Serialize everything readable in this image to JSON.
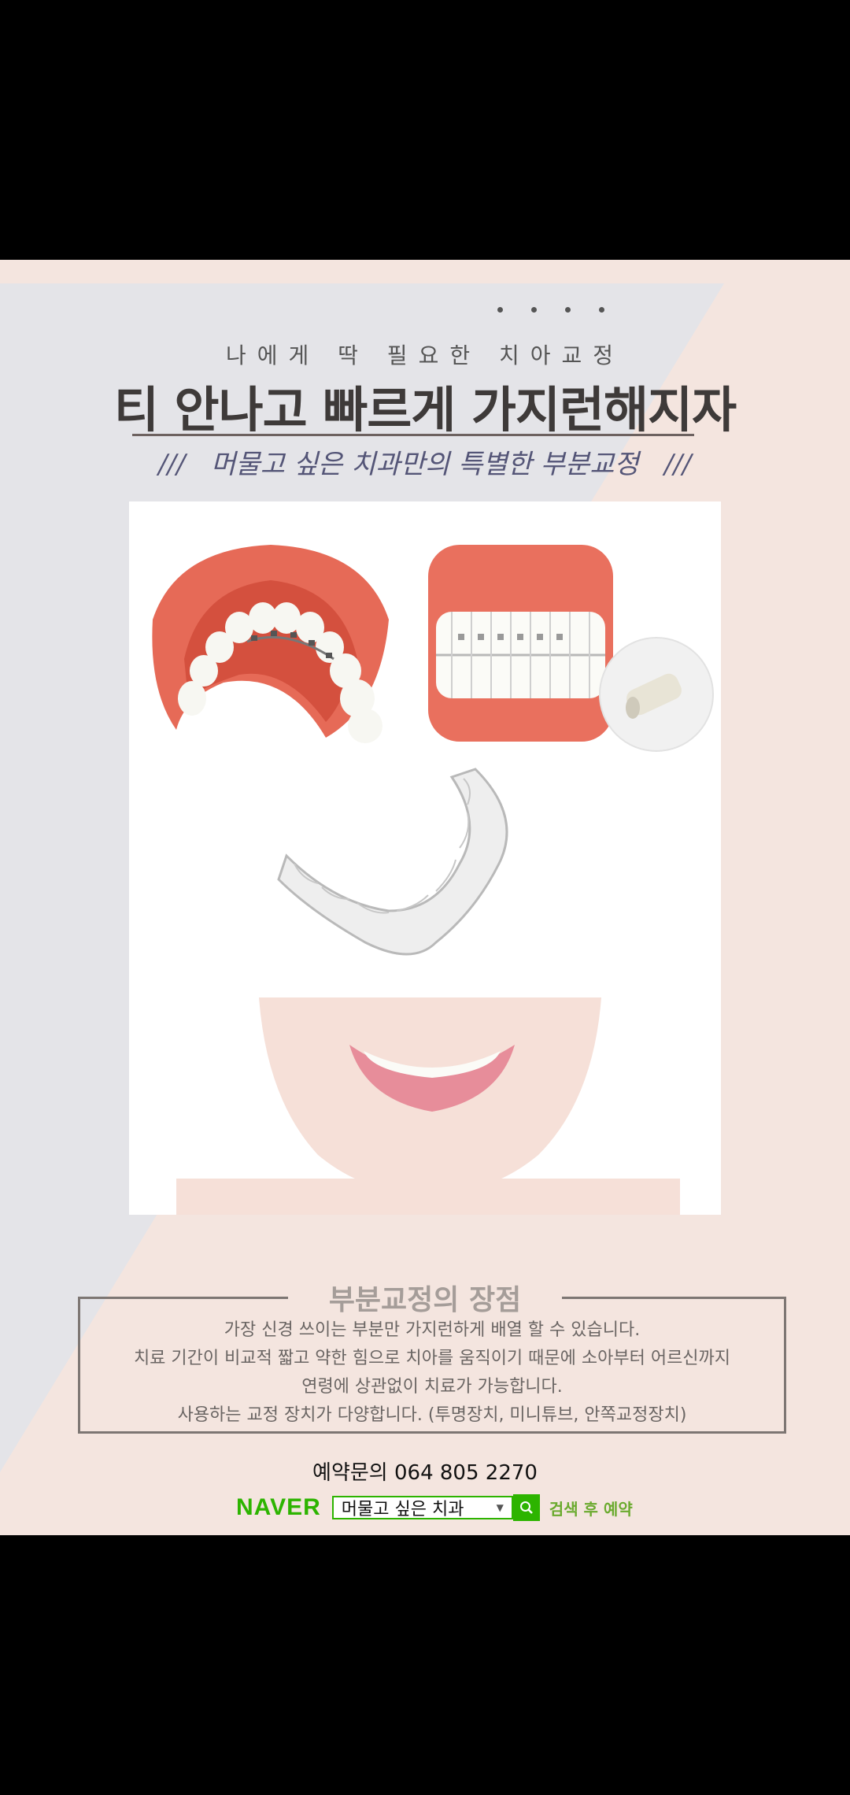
{
  "poster": {
    "subtitle": "나에게 딱 필요한 치아교정",
    "title": "티 안나고 빠르게 가지런해지자",
    "tagline": "///   머물고 싶은 치과만의 특별한 부분교정   ///"
  },
  "advantages": {
    "heading": "부분교정의 장점",
    "lines": [
      "가장 신경 쓰이는 부분만 가지런하게 배열 할 수 있습니다.",
      "치료 기간이 비교적 짧고 약한 힘으로 치아를 움직이기 때문에 소아부터 어르신까지",
      "연령에 상관없이 치료가 가능합니다.",
      "사용하는 교정 장치가 다양합니다. (투명장치, 미니튜브, 안쪽교정장치)"
    ]
  },
  "contact": {
    "phone": "예약문의 064 805 2270"
  },
  "naver": {
    "logo": "NAVER",
    "search_value": "머물고 싶은 치과",
    "action": "검색 후 예약"
  },
  "colors": {
    "accent_green": "#2db400",
    "poster_bg": "#f4e5df",
    "band_gray": "#e4e4e8"
  },
  "icons": [
    "search-icon",
    "dropdown-caret-icon"
  ]
}
